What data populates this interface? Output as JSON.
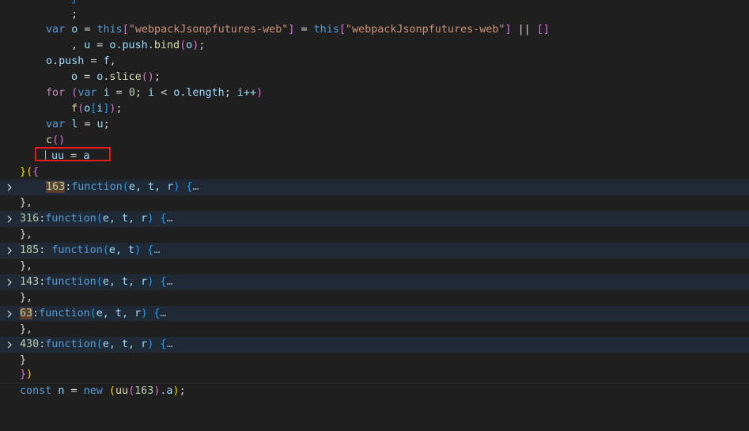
{
  "lines": {
    "l0": "}",
    "l1": ";",
    "l2": {
      "kw_var": "var",
      "o": "o",
      "eq": " = ",
      "this1": "this",
      "str1": "\"webpackJsonpfutures-web\"",
      "eq2": " = ",
      "this2": "this",
      "str2": "\"webpackJsonpfutures-web\"",
      "or": " || ",
      "arr": "[]"
    },
    "l3": {
      "pre": ", ",
      "u": "u",
      "eq": " = ",
      "o": "o",
      "dot1": ".",
      "push": "push",
      "dot2": ".",
      "bind": "bind",
      "args_o": "o",
      "end": ";"
    },
    "l4": {
      "o": "o",
      "dot": ".",
      "push": "push",
      "eq": " = ",
      "f": "f",
      "end": ","
    },
    "l5": {
      "o": "o",
      "eq": " = ",
      "o2": "o",
      "dot": ".",
      "slice": "slice",
      "end": ";"
    },
    "l6": {
      "for": "for",
      "var": "var",
      "i": "i",
      "eq": " = ",
      "zero": "0",
      "lt": " < ",
      "o": "o",
      "len": ".length",
      "ipp": "i++"
    },
    "l7": {
      "f": "f",
      "o": "o",
      "i": "i",
      "end": ";"
    },
    "l8": {
      "var": "var",
      "l": "l",
      "eq": " = ",
      "u": "u",
      "end": ";"
    },
    "l9": {
      "c": "c"
    },
    "l10": {
      "uu": "uu",
      "eq": " = ",
      "a": "a"
    },
    "l11": "}({",
    "folded": [
      {
        "key": "163",
        "colon": ":",
        "fn": "function",
        "params": "e, t, r",
        "ellipsis": "…"
      },
      {
        "key": "316",
        "colon": ":",
        "fn": "function",
        "params": "e, t, r",
        "ellipsis": "…"
      },
      {
        "key": "185",
        "colon": ": ",
        "fn": "function",
        "params": "e, t",
        "ellipsis": "…"
      },
      {
        "key": "143",
        "colon": ":",
        "fn": "function",
        "params": "e, t, r",
        "ellipsis": "…"
      },
      {
        "key": "63",
        "colon": ":",
        "fn": "function",
        "params": "e, t, r",
        "ellipsis": "…"
      },
      {
        "key": "430",
        "colon": ":",
        "fn": "function",
        "params": "e, t, r",
        "ellipsis": "…"
      }
    ],
    "sep": "},",
    "close_brace": "}",
    "close_all": "})",
    "last": {
      "const": "const",
      "n": "n",
      "eq": " = ",
      "new": "new",
      "uu": "uu",
      "num": "163",
      "a": ".a",
      "end": ";"
    }
  },
  "colors": {
    "background": "#1f1f1f",
    "keyword": "#569cd6",
    "variable": "#9cdcfe",
    "string": "#ce9178",
    "number": "#b5cea8",
    "function": "#dcdcaa",
    "highlight_box": "#e31b1b"
  },
  "icons": {
    "fold_chevron": "chevron-right-icon"
  }
}
